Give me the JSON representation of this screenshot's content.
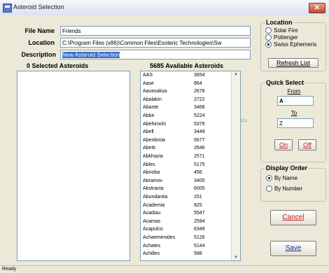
{
  "window": {
    "title": "Asteroid Selection",
    "close_glyph": "✕"
  },
  "form": {
    "file_name_label": "File Name",
    "file_name_value": "Friends",
    "location_label": "Location",
    "location_value": "C:\\Program Files (x86)\\Common Files\\Esoteric Technologies\\Sw",
    "description_label": "Description",
    "description_value": "New Asteroid Selection"
  },
  "selected_list": {
    "header": "0 Selected Asteroids"
  },
  "available_list": {
    "header": "5685 Available Asteroids",
    "rows": [
      {
        "name": "AAS",
        "number": "3654"
      },
      {
        "name": "Aase",
        "number": "864"
      },
      {
        "name": "Aavasaksa",
        "number": "2678"
      },
      {
        "name": "Abalakin",
        "number": "2722"
      },
      {
        "name": "Abante",
        "number": "3468"
      },
      {
        "name": "Abbe",
        "number": "5224"
      },
      {
        "name": "Abehiroshi",
        "number": "5379"
      },
      {
        "name": "Abell",
        "number": "3449"
      },
      {
        "name": "Aberdonia",
        "number": "5677"
      },
      {
        "name": "Abetti",
        "number": "2646"
      },
      {
        "name": "Abkhazia",
        "number": "2571"
      },
      {
        "name": "Ables",
        "number": "5175"
      },
      {
        "name": "Abnoba",
        "number": "456"
      },
      {
        "name": "Abramov",
        "number": "3405"
      },
      {
        "name": "Abstracta",
        "number": "6005"
      },
      {
        "name": "Abundantia",
        "number": "151"
      },
      {
        "name": "Academia",
        "number": "825"
      },
      {
        "name": "Acadiau",
        "number": "5547"
      },
      {
        "name": "Acamas",
        "number": "2594"
      },
      {
        "name": "Acapulco",
        "number": "6349"
      },
      {
        "name": "Achaemenides",
        "number": "5126"
      },
      {
        "name": "Achates",
        "number": "5144"
      },
      {
        "name": "Achilles",
        "number": "588"
      }
    ]
  },
  "location_group": {
    "title": "Location",
    "options": [
      "Solar Fire",
      "Pottenger",
      "Swiss Ephemeris"
    ],
    "selected": "Swiss Ephemeris",
    "refresh_label": "Refresh List"
  },
  "quick_select": {
    "title": "Quick Select",
    "from_label": "From",
    "from_value": "A",
    "to_label": "To",
    "to_value": "Z",
    "ok_label": "On",
    "off_label": "Off"
  },
  "display_order": {
    "title": "Display Order",
    "options": [
      "By Name",
      "By Number"
    ],
    "selected": "By Name"
  },
  "buttons": {
    "cancel": "Cancel",
    "save": "Save"
  },
  "status": {
    "text": "Ready"
  },
  "icons": {
    "app": "asteroid-app-icon",
    "transfer": "transfer-arrow-icon"
  },
  "colors": {
    "selection": "#316ac5",
    "cancel_text": "#c0202a",
    "save_text": "#1a2f9a"
  }
}
